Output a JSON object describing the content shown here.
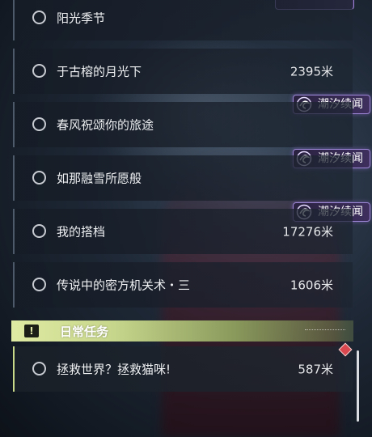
{
  "colors": {
    "accent_daily": "#c9d98a",
    "tag_purple": "#9e86d6",
    "marker_red": "#d8484e"
  },
  "quests": [
    {
      "title": "阳光季节",
      "distance": "",
      "tag": ""
    },
    {
      "title": "于古榕的月光下",
      "distance": "2395米",
      "tag": ""
    },
    {
      "title": "春风祝颂你的旅途",
      "distance": "",
      "tag": "潮汐续闻"
    },
    {
      "title": "如那融雪所愿般",
      "distance": "",
      "tag": "潮汐续闻"
    },
    {
      "title": "我的搭档",
      "distance": "17276米",
      "tag": "潮汐续闻"
    },
    {
      "title": "传说中的密方机关术・三",
      "distance": "1606米",
      "tag": ""
    }
  ],
  "daily_section": {
    "label": "日常任务",
    "icon": "exclamation-icon",
    "quests": [
      {
        "title": "拯救世界？拯救猫咪!",
        "distance": "587米"
      }
    ]
  }
}
